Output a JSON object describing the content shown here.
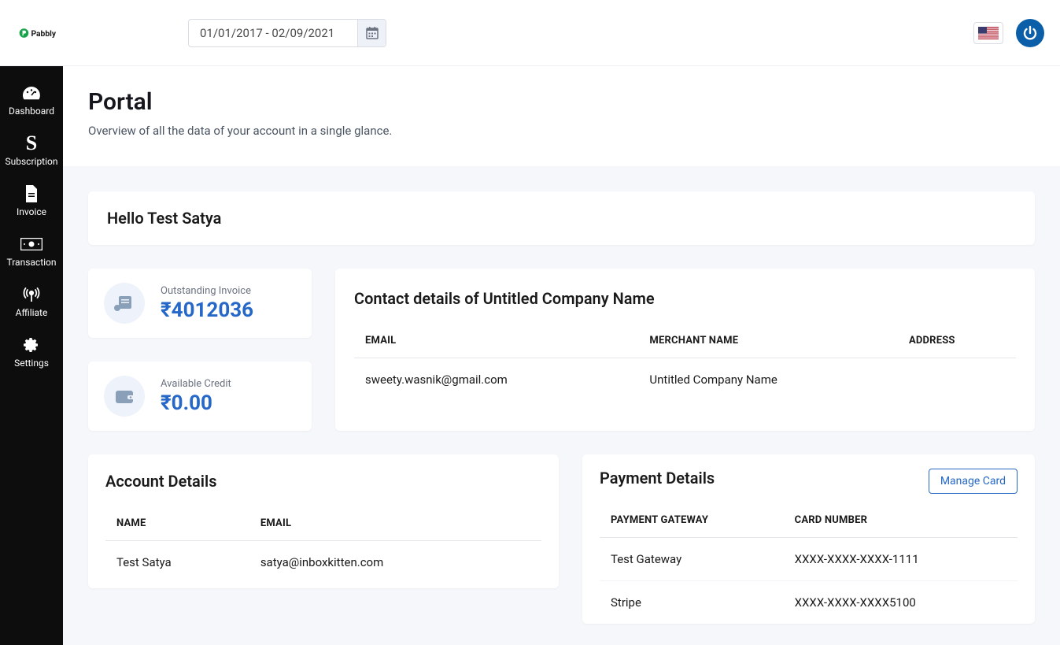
{
  "brand": {
    "name": "Pabbly"
  },
  "header": {
    "date_range": "01/01/2017 - 02/09/2021"
  },
  "sidebar": {
    "items": [
      {
        "label": "Dashboard"
      },
      {
        "label": "Subscription"
      },
      {
        "label": "Invoice"
      },
      {
        "label": "Transaction"
      },
      {
        "label": "Affiliate"
      },
      {
        "label": "Settings"
      }
    ]
  },
  "page": {
    "title": "Portal",
    "subtitle": "Overview of all the data of your account in a single glance."
  },
  "greeting": "Hello Test Satya",
  "metrics": {
    "outstanding_label": "Outstanding Invoice",
    "outstanding_value": "₹4012036",
    "credit_label": "Available Credit",
    "credit_value": "₹0.00"
  },
  "contact": {
    "title": "Contact details of Untitled Company Name",
    "headers": {
      "email": "EMAIL",
      "merchant": "MERCHANT NAME",
      "address": "ADDRESS"
    },
    "row": {
      "email": "sweety.wasnik@gmail.com",
      "merchant": "Untitled Company Name",
      "address": ""
    }
  },
  "account": {
    "title": "Account Details",
    "headers": {
      "name": "NAME",
      "email": "EMAIL"
    },
    "row": {
      "name": "Test Satya",
      "email": "satya@inboxkitten.com"
    }
  },
  "payment": {
    "title": "Payment Details",
    "manage_label": "Manage Card",
    "headers": {
      "gateway": "PAYMENT GATEWAY",
      "card": "CARD NUMBER"
    },
    "rows": [
      {
        "gateway": "Test Gateway",
        "card": "XXXX-XXXX-XXXX-1111"
      },
      {
        "gateway": "Stripe",
        "card": "XXXX-XXXX-XXXX5100"
      }
    ]
  }
}
